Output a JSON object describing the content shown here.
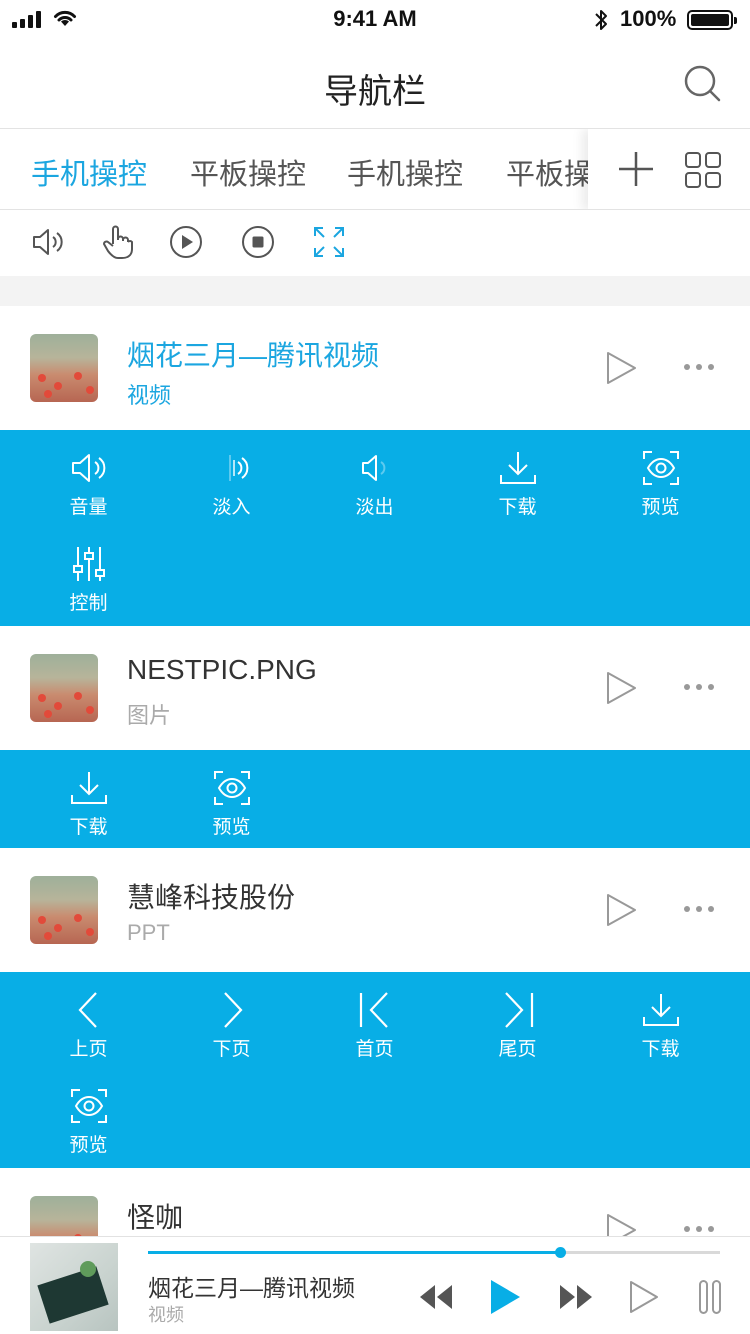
{
  "status_bar": {
    "time": "9:41 AM",
    "battery": "100%"
  },
  "nav": {
    "title": "导航栏"
  },
  "tabs": [
    {
      "label": "手机操控",
      "active": true
    },
    {
      "label": "平板操控",
      "active": false
    },
    {
      "label": "手机操控",
      "active": false
    },
    {
      "label": "平板操控",
      "active": false
    }
  ],
  "toolbar": {
    "icons": [
      "speaker-icon",
      "hand-pointer-icon",
      "play-circle-icon",
      "stop-circle-icon",
      "fullscreen-icon"
    ],
    "active": "fullscreen-icon"
  },
  "items": [
    {
      "title": "烟花三月—腾讯视频",
      "subtitle": "视频",
      "active": true,
      "actions": [
        {
          "label": "音量",
          "icon": "volume-icon"
        },
        {
          "label": "淡入",
          "icon": "fade-in-icon"
        },
        {
          "label": "淡出",
          "icon": "fade-out-icon"
        },
        {
          "label": "下载",
          "icon": "download-icon"
        },
        {
          "label": "预览",
          "icon": "preview-eye-icon"
        },
        {
          "label": "控制",
          "icon": "sliders-icon"
        }
      ]
    },
    {
      "title": "NESTPIC.PNG",
      "subtitle": "图片",
      "active": false,
      "actions": [
        {
          "label": "下载",
          "icon": "download-icon"
        },
        {
          "label": "预览",
          "icon": "preview-eye-icon"
        }
      ]
    },
    {
      "title": "慧峰科技股份",
      "subtitle": "PPT",
      "active": false,
      "actions": [
        {
          "label": "上页",
          "icon": "chevron-left-icon"
        },
        {
          "label": "下页",
          "icon": "chevron-right-icon"
        },
        {
          "label": "首页",
          "icon": "first-page-icon"
        },
        {
          "label": "尾页",
          "icon": "last-page-icon"
        },
        {
          "label": "下载",
          "icon": "download-icon"
        },
        {
          "label": "预览",
          "icon": "preview-eye-icon"
        }
      ]
    },
    {
      "title": "怪咖",
      "subtitle": "",
      "active": false,
      "actions": []
    }
  ],
  "player": {
    "title": "烟花三月—腾讯视频",
    "subtitle": "视频",
    "progress": 0.72
  },
  "colors": {
    "accent": "#08aee6",
    "accent_text": "#1ba6e0",
    "text": "#333333",
    "muted": "#aaaaaa"
  }
}
